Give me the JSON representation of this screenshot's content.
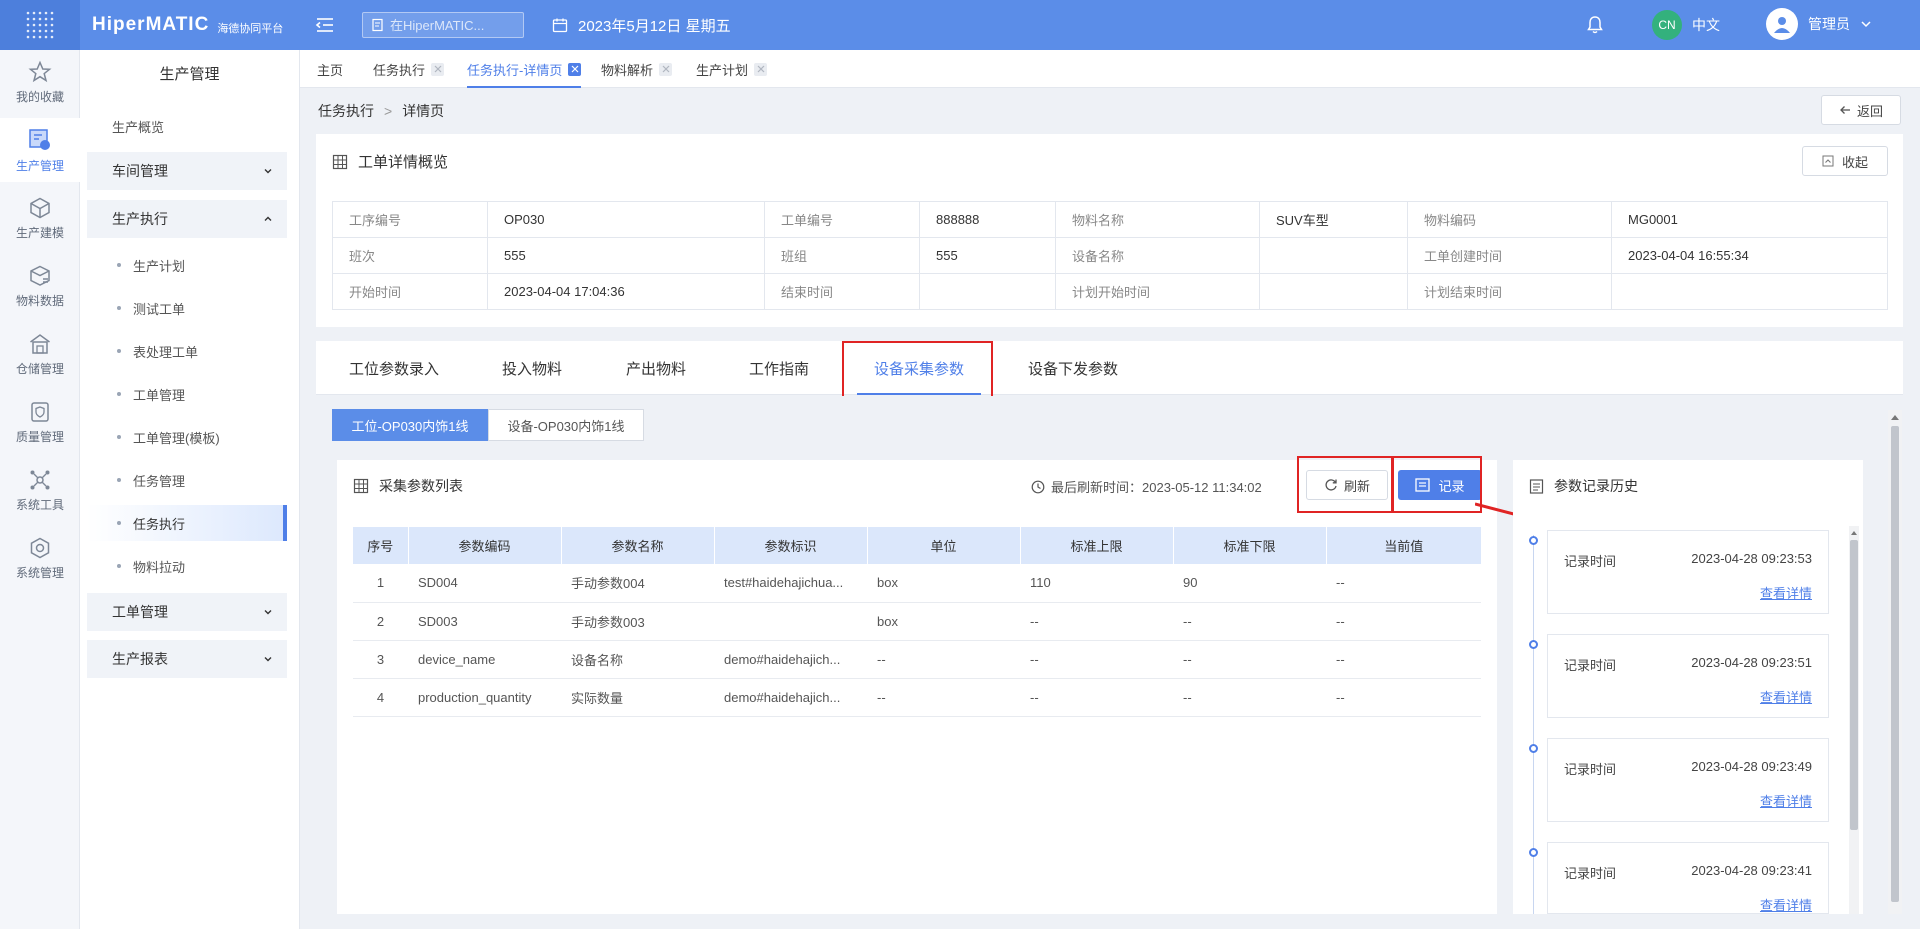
{
  "topbar": {
    "brand": "HiperMATIC",
    "brand_sub": "海德协同平台",
    "search_placeholder": "在HiperMATIC...",
    "date": "2023年5月12日 星期五",
    "lang_badge": "CN",
    "lang": "中文",
    "user": "管理员"
  },
  "rail": [
    {
      "label": "我的收藏",
      "icon": "star-icon"
    },
    {
      "label": "生产管理",
      "icon": "production-icon"
    },
    {
      "label": "生产建模",
      "icon": "cube-icon"
    },
    {
      "label": "物料数据",
      "icon": "box-icon"
    },
    {
      "label": "仓储管理",
      "icon": "warehouse-icon"
    },
    {
      "label": "质量管理",
      "icon": "shield-icon"
    },
    {
      "label": "系统工具",
      "icon": "network-icon"
    },
    {
      "label": "系统管理",
      "icon": "settings-icon"
    }
  ],
  "sidebar": {
    "title": "生产管理",
    "overview": "生产概览",
    "g1": "车间管理",
    "g2": "生产执行",
    "subs": [
      "生产计划",
      "测试工单",
      "表处理工单",
      "工单管理",
      "工单管理(模板)",
      "任务管理",
      "任务执行",
      "物料拉动"
    ],
    "g3": "工单管理",
    "g4": "生产报表"
  },
  "tabs": [
    "主页",
    "任务执行",
    "任务执行-详情页",
    "物料解析",
    "生产计划"
  ],
  "breadcrumb": {
    "parent": "任务执行",
    "sep": ">",
    "current": "详情页"
  },
  "back_label": "返回",
  "overview": {
    "title": "工单详情概览",
    "collapse_label": "收起",
    "rows": [
      [
        "工序编号",
        "OP030",
        "工单编号",
        "888888",
        "物料名称",
        "SUV车型",
        "物料编码",
        "MG0001"
      ],
      [
        "班次",
        "555",
        "班组",
        "555",
        "设备名称",
        "",
        "工单创建时间",
        "2023-04-04 16:55:34"
      ],
      [
        "开始时间",
        "2023-04-04 17:04:36",
        "结束时间",
        "",
        "计划开始时间",
        "",
        "计划结束时间",
        ""
      ]
    ]
  },
  "param_tabs": [
    "工位参数录入",
    "投入物料",
    "产出物料",
    "工作指南",
    "设备采集参数",
    "设备下发参数"
  ],
  "segments": [
    "工位-OP030内饰1线",
    "设备-OP030内饰1线"
  ],
  "param_list": {
    "title": "采集参数列表",
    "refresh_time": "最后刷新时间：2023-05-12 11:34:02",
    "refresh_label": "刷新",
    "record_label": "记录",
    "headers": [
      "序号",
      "参数编码",
      "参数名称",
      "参数标识",
      "单位",
      "标准上限",
      "标准下限",
      "当前值"
    ],
    "rows": [
      [
        "1",
        "SD004",
        "手动参数004",
        "test#haidehajichua...",
        "box",
        "110",
        "90",
        "--"
      ],
      [
        "2",
        "SD003",
        "手动参数003",
        "",
        "box",
        "--",
        "--",
        "--"
      ],
      [
        "3",
        "device_name",
        "设备名称",
        "demo#haidehajich...",
        "--",
        "--",
        "--",
        "--"
      ],
      [
        "4",
        "production_quantity",
        "实际数量",
        "demo#haidehajich...",
        "--",
        "--",
        "--",
        "--"
      ]
    ]
  },
  "history": {
    "title": "参数记录历史",
    "items": [
      {
        "label": "记录时间",
        "time": "2023-04-28 09:23:53",
        "link": "查看详情"
      },
      {
        "label": "记录时间",
        "time": "2023-04-28 09:23:51",
        "link": "查看详情"
      },
      {
        "label": "记录时间",
        "time": "2023-04-28 09:23:49",
        "link": "查看详情"
      },
      {
        "label": "记录时间",
        "time": "2023-04-28 09:23:41",
        "link": "查看详情"
      }
    ]
  },
  "colors": {
    "topbar": "#5b8de8",
    "accent": "#4f7fe8",
    "highlight": "#e02424",
    "header_row": "#dbe7fb"
  }
}
